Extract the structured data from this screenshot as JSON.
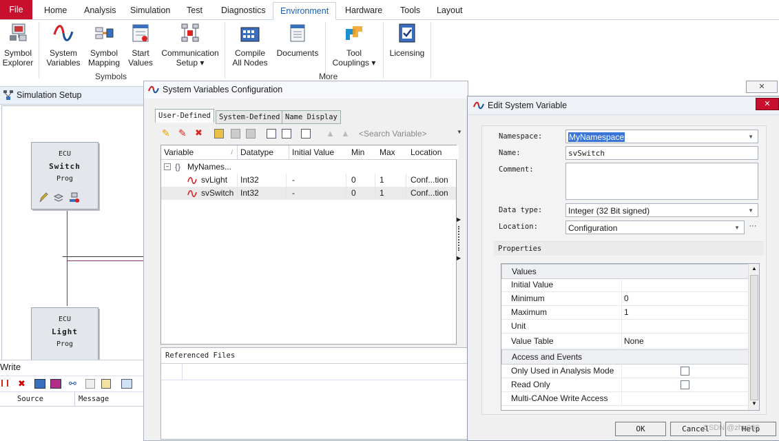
{
  "ribbon": {
    "file_label": "File",
    "tabs": [
      "Home",
      "Analysis",
      "Simulation",
      "Test",
      "Diagnostics",
      "Environment",
      "Hardware",
      "Tools",
      "Layout"
    ],
    "active_tab": "Environment",
    "buttons": [
      {
        "label1": "Symbol",
        "label2": "Explorer"
      },
      {
        "label1": "System",
        "label2": "Variables"
      },
      {
        "label1": "Symbol",
        "label2": "Mapping"
      },
      {
        "label1": "Start",
        "label2": "Values"
      },
      {
        "label1": "Communication",
        "label2": "Setup ▾"
      },
      {
        "label1": "Compile",
        "label2": "All Nodes"
      },
      {
        "label1": "Documents",
        "label2": ""
      },
      {
        "label1": "Tool",
        "label2": "Couplings ▾"
      },
      {
        "label1": "Licensing",
        "label2": ""
      }
    ],
    "group_symbols": "Symbols",
    "group_more": "More"
  },
  "sim_setup": {
    "title": "Simulation Setup",
    "ecus": [
      {
        "l1": "ECU",
        "l2": "Switch",
        "l3": "Prog"
      },
      {
        "l1": "ECU",
        "l2": "Light",
        "l3": "Prog"
      }
    ]
  },
  "write": {
    "title": "Write",
    "col_source": "Source",
    "col_message": "Message"
  },
  "svc": {
    "title": "System Variables Configuration",
    "tabs": [
      "User-Defined",
      "System-Defined",
      "Name Display"
    ],
    "search_placeholder": "<Search Variable>",
    "columns": [
      "Variable",
      "Datatype",
      "Initial Value",
      "Min",
      "Max",
      "Location"
    ],
    "namespace_row": "MyNames...",
    "rows": [
      {
        "name": "svLight",
        "type": "Int32",
        "init": "-",
        "min": "0",
        "max": "1",
        "loc": "Conf...tion"
      },
      {
        "name": "svSwitch",
        "type": "Int32",
        "init": "-",
        "min": "0",
        "max": "1",
        "loc": "Conf...tion"
      }
    ],
    "referenced_files": "Referenced Files"
  },
  "esv": {
    "title": "Edit System Variable",
    "labels": {
      "namespace": "Namespace:",
      "name": "Name:",
      "comment": "Comment:",
      "datatype": "Data type:",
      "location": "Location:"
    },
    "values": {
      "namespace": "MyNamespace",
      "name": "svSwitch",
      "comment": "",
      "datatype": "Integer (32 Bit signed)",
      "location": "Configuration"
    },
    "properties_label": "Properties",
    "cat_values": "Values",
    "cat_access": "Access and Events",
    "props": [
      {
        "name": "Initial Value",
        "value": ""
      },
      {
        "name": "Minimum",
        "value": "0"
      },
      {
        "name": "Maximum",
        "value": "1"
      },
      {
        "name": "Unit",
        "value": ""
      },
      {
        "name": "Value Table",
        "value": "None"
      }
    ],
    "access": [
      {
        "name": "Only Used in Analysis Mode",
        "checked": false
      },
      {
        "name": "Read Only",
        "checked": false
      },
      {
        "name": "Multi-CANoe Write Access",
        "checked": false
      }
    ],
    "ok_label": "OK",
    "cancel_label": "Cancel",
    "help_label": "Help",
    "watermark": "CSDN @zhu008"
  },
  "colors": {
    "file_red": "#c8102e",
    "accent_blue": "#1c5fb0",
    "selection": "#3875d7"
  }
}
